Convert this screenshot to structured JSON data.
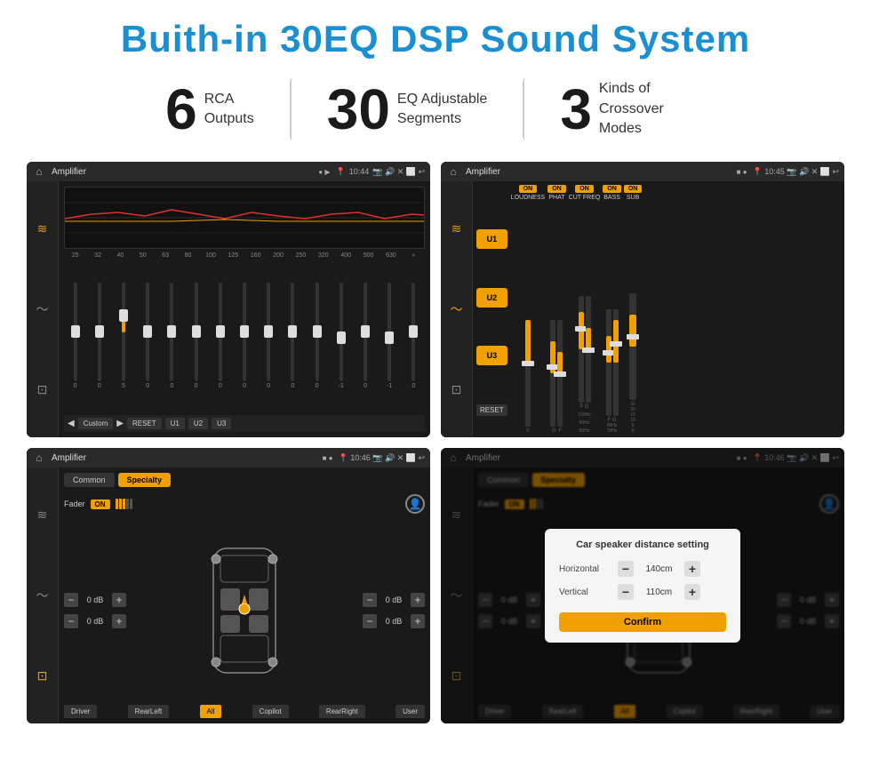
{
  "header": {
    "title": "Buith-in 30EQ DSP Sound System"
  },
  "features": [
    {
      "number": "6",
      "label": "RCA\nOutputs"
    },
    {
      "number": "30",
      "label": "EQ Adjustable\nSegments"
    },
    {
      "number": "3",
      "label": "Kinds of\nCrossover Modes"
    }
  ],
  "screens": {
    "eq_screen": {
      "title": "Amplifier",
      "time": "10:44",
      "freq_labels": [
        "25",
        "32",
        "40",
        "50",
        "63",
        "80",
        "100",
        "125",
        "160",
        "200",
        "250",
        "320",
        "400",
        "500",
        "630"
      ],
      "bottom_buttons": [
        "Custom",
        "RESET",
        "U1",
        "U2",
        "U3"
      ]
    },
    "crossover_screen": {
      "title": "Amplifier",
      "time": "10:45",
      "u_buttons": [
        "U1",
        "U2",
        "U3"
      ],
      "channels": [
        {
          "label": "LOUDNESS",
          "on": true
        },
        {
          "label": "PHAT",
          "on": true
        },
        {
          "label": "CUT FREQ",
          "on": true
        },
        {
          "label": "BASS",
          "on": true
        },
        {
          "label": "SUB",
          "on": true
        }
      ],
      "reset_label": "RESET"
    },
    "fader_screen": {
      "title": "Amplifier",
      "time": "10:46",
      "mode_tabs": [
        "Common",
        "Specialty"
      ],
      "fader_label": "Fader",
      "on_label": "ON",
      "db_values": [
        "0 dB",
        "0 dB",
        "0 dB",
        "0 dB"
      ],
      "bottom_buttons": [
        "Driver",
        "RearLeft",
        "All",
        "Copilot",
        "RearRight",
        "User"
      ]
    },
    "distance_screen": {
      "title": "Amplifier",
      "time": "10:46",
      "mode_tabs": [
        "Common",
        "Specialty"
      ],
      "on_label": "ON",
      "dialog": {
        "title": "Car speaker distance setting",
        "horizontal_label": "Horizontal",
        "horizontal_value": "140cm",
        "vertical_label": "Vertical",
        "vertical_value": "110cm",
        "confirm_label": "Confirm"
      },
      "bottom_buttons": [
        "Driver",
        "RearLeft",
        "All",
        "Copilot",
        "RearRight",
        "User"
      ]
    }
  },
  "icons": {
    "home": "⌂",
    "location": "📍",
    "play": "▶",
    "back": "↩",
    "volume": "🔊",
    "eq_icon": "≋",
    "wave_icon": "〜",
    "speaker_icon": "🔈"
  }
}
